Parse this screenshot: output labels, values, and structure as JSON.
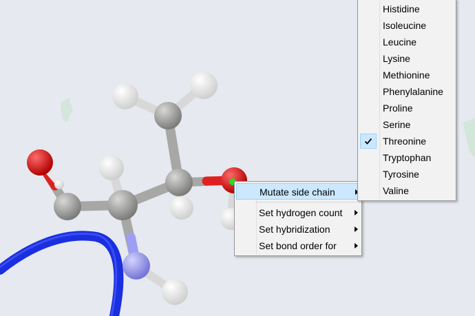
{
  "context_menu": {
    "items": [
      {
        "label": "Mutate side chain",
        "has_submenu": true,
        "highlighted": true
      },
      {
        "separator": true
      },
      {
        "label": "Set hydrogen count",
        "has_submenu": true
      },
      {
        "label": "Set hybridization",
        "has_submenu": true
      },
      {
        "label": "Set bond order for",
        "has_submenu": true
      }
    ]
  },
  "submenu": {
    "items": [
      {
        "label": "Histidine"
      },
      {
        "label": "Isoleucine"
      },
      {
        "label": "Leucine"
      },
      {
        "label": "Lysine"
      },
      {
        "label": "Methionine"
      },
      {
        "label": "Phenylalanine"
      },
      {
        "label": "Proline"
      },
      {
        "label": "Serine"
      },
      {
        "label": "Threonine",
        "checked": true
      },
      {
        "label": "Tryptophan"
      },
      {
        "label": "Tyrosine"
      },
      {
        "label": "Valine"
      }
    ]
  },
  "colors": {
    "background": "#e6e9ef",
    "carbon": "#9a9a98",
    "hydrogen": "#f4f4f4",
    "oxygen": "#e02020",
    "nitrogen": "#9e9ef2",
    "ribbon": "#1a2fe0",
    "selection_marker": "#22dd22",
    "menu_highlight": "#cce8ff"
  }
}
